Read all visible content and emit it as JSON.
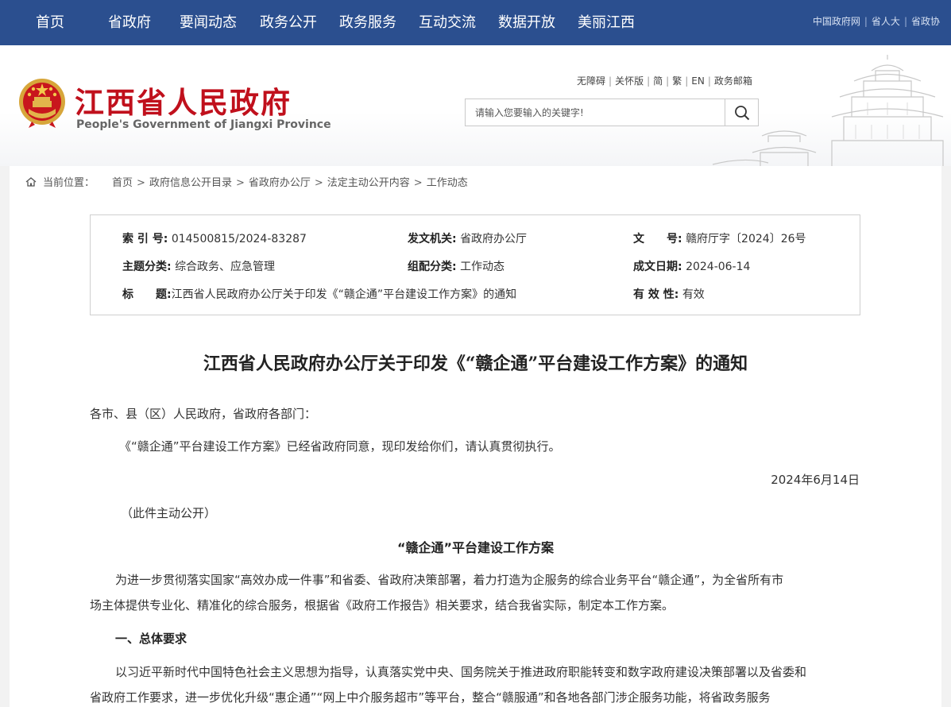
{
  "topnav": {
    "items": [
      "首页",
      "省政府",
      "要闻动态",
      "政务公开",
      "政务服务",
      "互动交流",
      "数据开放",
      "美丽江西"
    ],
    "links": [
      "中国政府网",
      "省人大",
      "省政协"
    ]
  },
  "header": {
    "title_cn": "江西省人民政府",
    "title_en": "People's Government of Jiangxi Province",
    "tool_links": [
      "无障碍",
      "关怀版",
      "简",
      "繁",
      "EN",
      "政务邮箱"
    ],
    "search_placeholder": "请输入您要输入的关键字!"
  },
  "breadcrumb": {
    "label": "当前位置：",
    "items": [
      "首页",
      "政府信息公开目录",
      "省政府办公厅",
      "法定主动公开内容",
      "工作动态"
    ]
  },
  "meta": {
    "index_label": "索 引 号:",
    "index_value": "014500815/2024-83287",
    "issuer_label": "发文机关:",
    "issuer_value": "省政府办公厅",
    "docno_label": "文　　号:",
    "docno_value": "赣府厅字〔2024〕26号",
    "topic_label": "主题分类:",
    "topic_value": "综合政务、应急管理",
    "group_label": "组配分类:",
    "group_value": "工作动态",
    "date_label": "成文日期:",
    "date_value": "2024-06-14",
    "title_label": "标　　题:",
    "title_value": "江西省人民政府办公厅关于印发《“赣企通”平台建设工作方案》的通知",
    "valid_label": "有 效 性:",
    "valid_value": "有效"
  },
  "document": {
    "title": "江西省人民政府办公厅关于印发《“赣企通”平台建设工作方案》的通知",
    "salutation": "各市、县（区）人民政府，省政府各部门：",
    "intro": "《“赣企通”平台建设工作方案》已经省政府同意，现印发给你们，请认真贯彻执行。",
    "date": "2024年6月14日",
    "note": "（此件主动公开）",
    "plan_title": "“赣企通”平台建设工作方案",
    "para1_line1": "为进一步贯彻落实国家“高效办成一件事”和省委、省政府决策部署，着力打造为企服务的综合业务平台“赣企通”，为全省所有市",
    "para1_line2": "场主体提供专业化、精准化的综合服务，根据省《政府工作报告》相关要求，结合我省实际，制定本工作方案。",
    "section1": "一、总体要求",
    "para2_line1": "以习近平新时代中国特色社会主义思想为指导，认真落实党中央、国务院关于推进政府职能转变和数字政府建设决策部署以及省委和",
    "para2_line2": "省政府工作要求，进一步优化升级“惠企通”“网上中介服务超市”等平台，整合“赣服通”和各地各部门涉企服务功能，将省政务服务"
  }
}
